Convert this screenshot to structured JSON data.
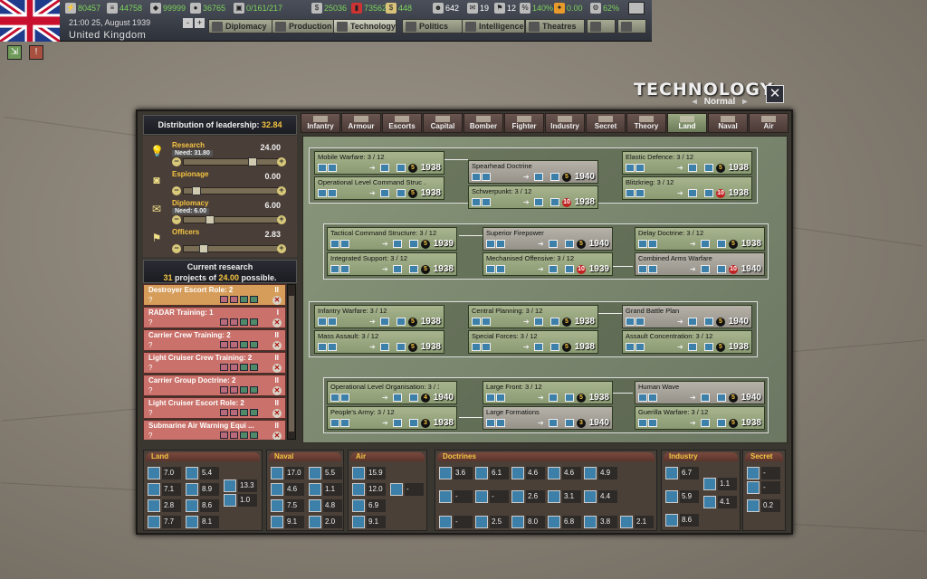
{
  "topbar": {
    "resources": [
      {
        "icon": "energy-icon",
        "value": "80457"
      },
      {
        "icon": "metal-icon",
        "value": "44758"
      },
      {
        "icon": "rare-materials-icon",
        "value": "99999"
      },
      {
        "icon": "oil-icon",
        "value": "36765"
      },
      {
        "icon": "supplies-icon",
        "value": "0/161/217"
      },
      {
        "icon": "money-icon",
        "value": "25036"
      },
      {
        "icon": "fuel-icon",
        "value": "73562"
      },
      {
        "icon": "cash-icon",
        "value": "448"
      },
      {
        "icon": "manpower-icon",
        "value": "642"
      },
      {
        "icon": "diplomacy-icon",
        "value": "19"
      },
      {
        "icon": "officers-icon",
        "value": "12"
      },
      {
        "icon": "dissent-icon",
        "value": "140%"
      },
      {
        "icon": "unity-icon",
        "value": "0.00"
      },
      {
        "icon": "ic-icon",
        "value": "62%"
      }
    ],
    "date": "21:00 25, August 1939",
    "country": "United Kingdom",
    "speed_minus": "-",
    "speed_plus": "+",
    "tabs": [
      "Diplomacy",
      "Production",
      "Technology",
      "Politics",
      "Intelligence",
      "Theatres"
    ]
  },
  "window": {
    "title": "TECHNOLOGY",
    "difficulty": "Normal",
    "close": "✕"
  },
  "leadership": {
    "header": "Distribution of leadership:",
    "total": "32.84",
    "rows": [
      {
        "label": "Research",
        "need": "Need: 31.80",
        "value": "24.00",
        "icon": "lightbulb-icon",
        "slider": 0.75
      },
      {
        "label": "Espionage",
        "need": "",
        "value": "0.00",
        "icon": "camera-icon",
        "slider": 0.1
      },
      {
        "label": "Diplomacy",
        "need": "Need: 6.00",
        "value": "6.00",
        "icon": "envelope-icon",
        "slider": 0.25
      },
      {
        "label": "Officers",
        "need": "",
        "value": "2.83",
        "icon": "flag-icon",
        "slider": 0.18
      }
    ]
  },
  "research": {
    "header": "Current research",
    "projects": "31",
    "projects_text": "projects of",
    "possible": "24.00",
    "possible_text": "possible.",
    "queue": [
      {
        "name": "Destroyer Escort Role: 2",
        "q": "?",
        "roman": "II"
      },
      {
        "name": "RADAR Training: 1",
        "q": "?",
        "roman": "I"
      },
      {
        "name": "Carrier Crew Training: 2",
        "q": "?",
        "roman": "II"
      },
      {
        "name": "Light Cruiser Crew Training: 2",
        "q": "?",
        "roman": "II"
      },
      {
        "name": "Carrier Group Doctrine: 2",
        "q": "?",
        "roman": "II"
      },
      {
        "name": "Light Cruiser Escort Role: 2",
        "q": "?",
        "roman": "II"
      },
      {
        "name": "Submarine Air Warning Equi ...",
        "q": "?",
        "roman": "II"
      }
    ]
  },
  "tabs": [
    "Infantry",
    "Armour",
    "Escorts",
    "Capital",
    "Bomber",
    "Fighter",
    "Industry",
    "Secret",
    "Theory",
    "Land",
    "Naval",
    "Air"
  ],
  "active_tab": "Land",
  "tree": [
    {
      "name": "Mobile Warfare: 3 / 12",
      "num": "5",
      "year": "1938",
      "red": false,
      "grey": false
    },
    {
      "name": "Spearhead Doctrine",
      "num": "5",
      "year": "1940",
      "red": false,
      "grey": true
    },
    {
      "name": "Elastic Defence: 3 / 12",
      "num": "5",
      "year": "1938",
      "red": false,
      "grey": false
    },
    {
      "name": "Operational Level Command Struc ...",
      "num": "5",
      "year": "1938",
      "red": false,
      "grey": false
    },
    {
      "name": "Schwerpunkt: 3 / 12",
      "num": "10",
      "year": "1938",
      "red": true,
      "grey": false
    },
    {
      "name": "Blitzkrieg: 3 / 12",
      "num": "10",
      "year": "1938",
      "red": true,
      "grey": false
    },
    {
      "name": "Tactical Command Structure: 3 / 12",
      "num": "5",
      "year": "1939",
      "red": false,
      "grey": false
    },
    {
      "name": "Superior Firepower",
      "num": "5",
      "year": "1940",
      "red": false,
      "grey": true
    },
    {
      "name": "Delay Doctrine: 3 / 12",
      "num": "5",
      "year": "1938",
      "red": false,
      "grey": false
    },
    {
      "name": "Integrated Support: 3 / 12",
      "num": "5",
      "year": "1938",
      "red": false,
      "grey": false
    },
    {
      "name": "Mechanised Offensive: 3 / 12",
      "num": "10",
      "year": "1939",
      "red": true,
      "grey": false
    },
    {
      "name": "Combined Arms Warfare",
      "num": "10",
      "year": "1940",
      "red": true,
      "grey": true
    },
    {
      "name": "Infantry Warfare: 3 / 12",
      "num": "5",
      "year": "1938",
      "red": false,
      "grey": false
    },
    {
      "name": "Central Planning: 3 / 12",
      "num": "5",
      "year": "1938",
      "red": false,
      "grey": false
    },
    {
      "name": "Grand Battle Plan",
      "num": "5",
      "year": "1940",
      "red": false,
      "grey": true
    },
    {
      "name": "Mass Assault: 3 / 12",
      "num": "5",
      "year": "1938",
      "red": false,
      "grey": false
    },
    {
      "name": "Special Forces: 3 / 12",
      "num": "5",
      "year": "1938",
      "red": false,
      "grey": false
    },
    {
      "name": "Assault Concentration: 3 / 12",
      "num": "5",
      "year": "1938",
      "red": false,
      "grey": false
    },
    {
      "name": "Operational Level Organisation: 3 / 12",
      "num": "4",
      "year": "1940",
      "red": false,
      "grey": false
    },
    {
      "name": "Large Front: 3 / 12",
      "num": "5",
      "year": "1938",
      "red": false,
      "grey": false
    },
    {
      "name": "Human Wave",
      "num": "5",
      "year": "1940",
      "red": false,
      "grey": true
    },
    {
      "name": "People's Army: 3 / 12",
      "num": "3",
      "year": "1938",
      "red": false,
      "grey": false
    },
    {
      "name": "Large Formations",
      "num": "3",
      "year": "1940",
      "red": false,
      "grey": true
    },
    {
      "name": "Guerilla Warfare: 3 / 12",
      "num": "5",
      "year": "1938",
      "red": false,
      "grey": false
    }
  ],
  "summary": {
    "land": {
      "title": "Land",
      "values": [
        "7.0",
        "5.4",
        "7.1",
        "8.9",
        "2.8",
        "8.6",
        "7.7",
        "8.1",
        "13.3",
        "1.0"
      ]
    },
    "naval": {
      "title": "Naval",
      "values": [
        "17.0",
        "5.5",
        "4.6",
        "1.1",
        "7.5",
        "4.8",
        "9.1",
        "2.0"
      ]
    },
    "air": {
      "title": "Air",
      "values": [
        "15.9",
        "12.0",
        "6.9",
        "9.1",
        "-"
      ]
    },
    "doctrines": {
      "title": "Doctrines",
      "values": [
        "3.6",
        "6.1",
        "4.6",
        "4.6",
        "4.9",
        "-",
        "-",
        "2.6",
        "3.1",
        "4.4",
        "-",
        "2.5",
        "8.0",
        "6.8",
        "3.8",
        "2.1"
      ]
    },
    "industry": {
      "title": "Industry",
      "values": [
        "6.7",
        "5.9",
        "1.1",
        "4.1",
        "8.6"
      ]
    },
    "secret": {
      "title": "Secret",
      "values": [
        "-",
        "-",
        "0.2"
      ]
    }
  }
}
